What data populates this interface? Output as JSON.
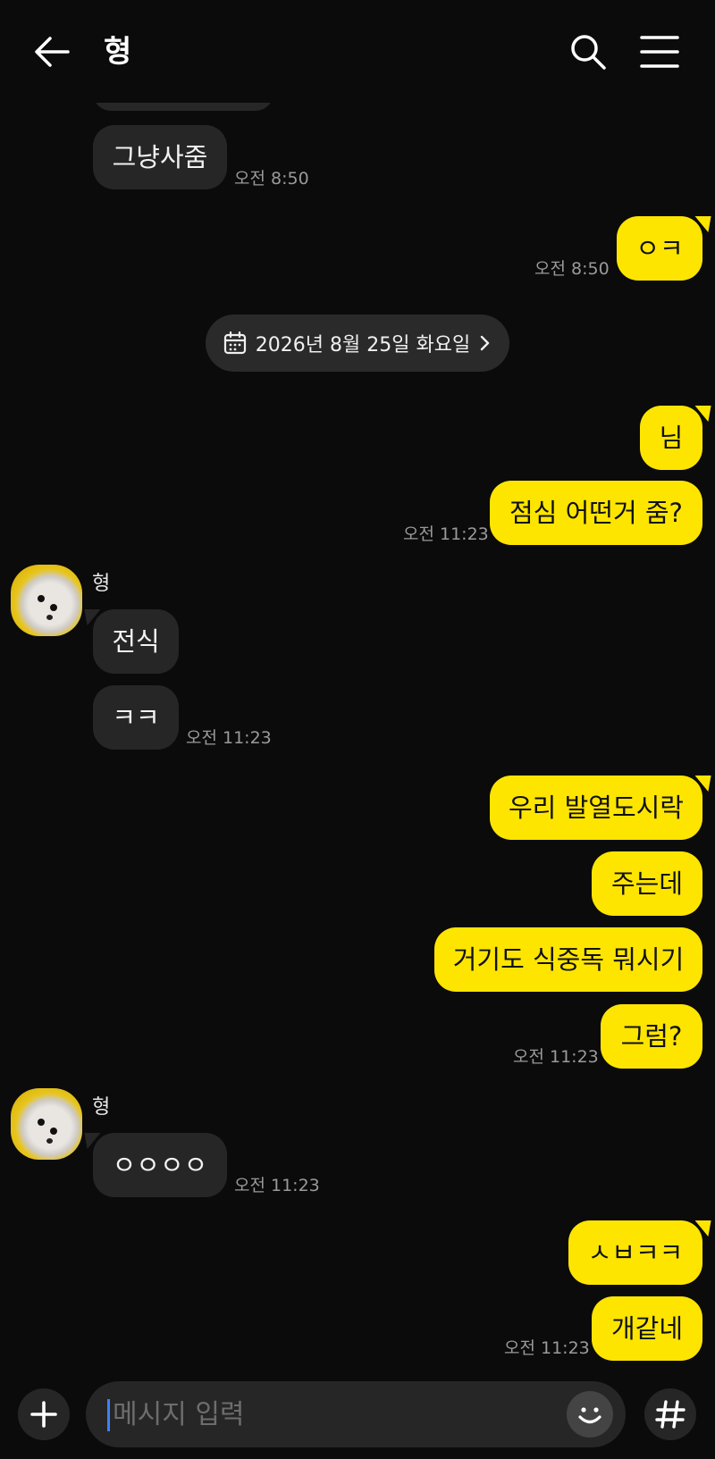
{
  "header": {
    "title": "형"
  },
  "date_divider": "2026년 8월 25일 화요일",
  "messages": [
    {
      "id": "m1",
      "side": "in",
      "text": "그냥사줌",
      "time": "오전 8:50"
    },
    {
      "id": "m2",
      "side": "out",
      "text": "ㅇㅋ",
      "time": "오전 8:50"
    },
    {
      "id": "m3",
      "side": "out",
      "text": "님"
    },
    {
      "id": "m4",
      "side": "out",
      "text": "점심 어떤거 줌?",
      "time": "오전 11:23"
    },
    {
      "id": "m5",
      "side": "in",
      "sender": "형",
      "text": "전식"
    },
    {
      "id": "m6",
      "side": "in",
      "text": "ㅋㅋ",
      "time": "오전 11:23"
    },
    {
      "id": "m7",
      "side": "out",
      "text": "우리 발열도시락"
    },
    {
      "id": "m8",
      "side": "out",
      "text": "주는데"
    },
    {
      "id": "m9",
      "side": "out",
      "text": "거기도 식중독 뭐시기"
    },
    {
      "id": "m10",
      "side": "out",
      "text": "그럼?",
      "time": "오전 11:23"
    },
    {
      "id": "m11",
      "side": "in",
      "sender": "형",
      "text": "ㅇㅇㅇㅇ",
      "time": "오전 11:23"
    },
    {
      "id": "m12",
      "side": "out",
      "text": "ㅅㅂㅋㅋ"
    },
    {
      "id": "m13",
      "side": "out",
      "text": "개같네",
      "time": "오전 11:23"
    }
  ],
  "composer": {
    "placeholder": "메시지 입력"
  },
  "colors": {
    "background": "#0b0b0b",
    "outgoing_bubble": "#fee500",
    "incoming_bubble": "#262626",
    "caret": "#3b82f6"
  },
  "icons": [
    "back-arrow-icon",
    "search-icon",
    "menu-icon",
    "calendar-icon",
    "chevron-right-icon",
    "plus-icon",
    "emoji-icon",
    "hash-icon"
  ]
}
